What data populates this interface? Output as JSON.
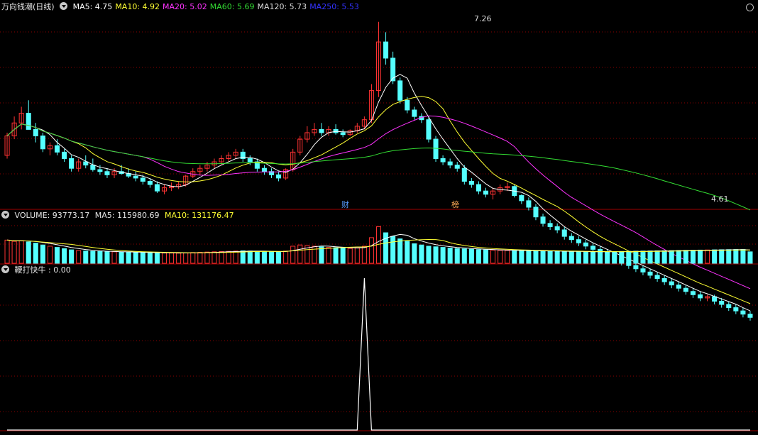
{
  "price_panel": {
    "title": "万向钱潮(日线)",
    "ma": [
      {
        "label": "MA5: 4.75",
        "color": "#ffffff"
      },
      {
        "label": "MA10: 4.92",
        "color": "#ffff33"
      },
      {
        "label": "MA20: 5.02",
        "color": "#ff33ff"
      },
      {
        "label": "MA60: 5.69",
        "color": "#33dd33"
      },
      {
        "label": "MA120: 5.73",
        "color": "#dddddd"
      },
      {
        "label": "MA250: 5.53",
        "color": "#3333ff"
      }
    ],
    "high_label": "7.26",
    "low_label": "4.61",
    "marker_cai": "财",
    "marker_bang": "榜"
  },
  "volume_panel": {
    "label": "VOLUME: 93773.17",
    "ma5": "MA5: 115980.69",
    "ma10": "MA10: 131176.47"
  },
  "indicator_panel": {
    "label": "鞭打快牛 : 0.00"
  },
  "colors": {
    "up": "#ff3333",
    "down": "#55ffff",
    "grid": "#8b0000",
    "axis": "#a00000"
  },
  "chart_data": [
    {
      "type": "candlestick",
      "title": "万向钱潮(日线)",
      "ohlc": [
        [
          5.2,
          5.55,
          5.15,
          5.5
        ],
        [
          5.5,
          5.8,
          5.45,
          5.7
        ],
        [
          5.7,
          5.95,
          5.6,
          5.85
        ],
        [
          5.85,
          6.05,
          5.75,
          5.6
        ],
        [
          5.6,
          5.7,
          5.4,
          5.5
        ],
        [
          5.5,
          5.55,
          5.25,
          5.3
        ],
        [
          5.3,
          5.4,
          5.2,
          5.35
        ],
        [
          5.35,
          5.45,
          5.2,
          5.25
        ],
        [
          5.25,
          5.3,
          5.1,
          5.15
        ],
        [
          5.15,
          5.2,
          4.95,
          5.0
        ],
        [
          5.0,
          5.15,
          4.95,
          5.1
        ],
        [
          5.1,
          5.2,
          5.0,
          5.05
        ],
        [
          5.05,
          5.15,
          4.95,
          4.98
        ],
        [
          4.98,
          5.05,
          4.9,
          4.95
        ],
        [
          4.95,
          5.0,
          4.85,
          4.9
        ],
        [
          4.9,
          5.0,
          4.85,
          4.95
        ],
        [
          4.95,
          5.05,
          4.9,
          4.92
        ],
        [
          4.92,
          5.0,
          4.85,
          4.88
        ],
        [
          4.88,
          4.95,
          4.8,
          4.85
        ],
        [
          4.85,
          4.9,
          4.75,
          4.8
        ],
        [
          4.8,
          4.85,
          4.7,
          4.75
        ],
        [
          4.75,
          4.8,
          4.62,
          4.65
        ],
        [
          4.65,
          4.75,
          4.6,
          4.7
        ],
        [
          4.7,
          4.78,
          4.65,
          4.72
        ],
        [
          4.72,
          4.8,
          4.68,
          4.75
        ],
        [
          4.75,
          4.9,
          4.72,
          4.88
        ],
        [
          4.88,
          5.0,
          4.85,
          4.95
        ],
        [
          4.95,
          5.05,
          4.9,
          5.0
        ],
        [
          5.0,
          5.1,
          4.95,
          5.05
        ],
        [
          5.05,
          5.15,
          5.0,
          5.1
        ],
        [
          5.1,
          5.2,
          5.05,
          5.15
        ],
        [
          5.15,
          5.25,
          5.1,
          5.2
        ],
        [
          5.2,
          5.3,
          5.15,
          5.25
        ],
        [
          5.25,
          5.3,
          5.1,
          5.15
        ],
        [
          5.15,
          5.2,
          5.05,
          5.1
        ],
        [
          5.1,
          5.15,
          4.95,
          5.0
        ],
        [
          5.0,
          5.05,
          4.9,
          4.95
        ],
        [
          4.95,
          5.0,
          4.85,
          4.9
        ],
        [
          4.9,
          4.95,
          4.8,
          4.85
        ],
        [
          4.85,
          5.0,
          4.82,
          4.98
        ],
        [
          4.98,
          5.3,
          4.95,
          5.25
        ],
        [
          5.25,
          5.5,
          5.2,
          5.45
        ],
        [
          5.45,
          5.65,
          5.4,
          5.55
        ],
        [
          5.55,
          5.7,
          5.5,
          5.6
        ],
        [
          5.6,
          5.7,
          5.5,
          5.55
        ],
        [
          5.55,
          5.65,
          5.5,
          5.6
        ],
        [
          5.6,
          5.68,
          5.52,
          5.55
        ],
        [
          5.55,
          5.6,
          5.48,
          5.52
        ],
        [
          5.52,
          5.6,
          5.5,
          5.58
        ],
        [
          5.58,
          5.7,
          5.55,
          5.65
        ],
        [
          5.65,
          5.8,
          5.6,
          5.75
        ],
        [
          5.75,
          6.3,
          5.7,
          6.2
        ],
        [
          6.2,
          7.26,
          6.1,
          6.95
        ],
        [
          6.95,
          7.1,
          6.6,
          6.7
        ],
        [
          6.7,
          6.8,
          6.3,
          6.35
        ],
        [
          6.35,
          6.4,
          6.0,
          6.05
        ],
        [
          6.05,
          6.1,
          5.85,
          5.9
        ],
        [
          5.9,
          5.95,
          5.75,
          5.8
        ],
        [
          5.8,
          5.85,
          5.7,
          5.75
        ],
        [
          5.75,
          5.8,
          5.4,
          5.45
        ],
        [
          5.45,
          5.5,
          5.1,
          5.15
        ],
        [
          5.15,
          5.2,
          5.05,
          5.1
        ],
        [
          5.1,
          5.15,
          5.0,
          5.05
        ],
        [
          5.05,
          5.1,
          4.95,
          5.0
        ],
        [
          5.0,
          5.05,
          4.75,
          4.8
        ],
        [
          4.8,
          4.85,
          4.7,
          4.75
        ],
        [
          4.75,
          4.8,
          4.6,
          4.65
        ],
        [
          4.65,
          4.7,
          4.55,
          4.6
        ],
        [
          4.6,
          4.7,
          4.52,
          4.65
        ],
        [
          4.65,
          4.75,
          4.6,
          4.7
        ],
        [
          4.7,
          4.78,
          4.65,
          4.72
        ],
        [
          4.72,
          4.75,
          4.55,
          4.58
        ],
        [
          4.58,
          4.6,
          4.45,
          4.5
        ],
        [
          4.5,
          4.55,
          4.35,
          4.4
        ],
        [
          4.4,
          4.45,
          4.2,
          4.25
        ],
        [
          4.25,
          4.3,
          4.1,
          4.15
        ],
        [
          4.15,
          4.2,
          4.05,
          4.1
        ],
        [
          4.1,
          4.15,
          4.0,
          4.05
        ],
        [
          4.05,
          4.1,
          3.9,
          3.95
        ],
        [
          3.95,
          4.0,
          3.85,
          3.9
        ],
        [
          3.9,
          3.95,
          3.8,
          3.85
        ],
        [
          3.85,
          3.9,
          3.75,
          3.8
        ],
        [
          3.8,
          3.85,
          3.7,
          3.75
        ],
        [
          3.75,
          3.8,
          3.65,
          3.7
        ],
        [
          3.7,
          3.75,
          3.6,
          3.65
        ],
        [
          3.65,
          3.7,
          3.55,
          3.6
        ],
        [
          3.6,
          3.62,
          3.5,
          3.55
        ],
        [
          3.55,
          3.58,
          3.45,
          3.5
        ],
        [
          3.5,
          3.55,
          3.4,
          3.45
        ],
        [
          3.45,
          3.5,
          3.35,
          3.4
        ],
        [
          3.4,
          3.45,
          3.3,
          3.35
        ],
        [
          3.35,
          3.4,
          3.25,
          3.3
        ],
        [
          3.3,
          3.35,
          3.2,
          3.25
        ],
        [
          3.25,
          3.3,
          3.15,
          3.2
        ],
        [
          3.2,
          3.25,
          3.1,
          3.15
        ],
        [
          3.15,
          3.2,
          3.05,
          3.1
        ],
        [
          3.1,
          3.15,
          3.0,
          3.05
        ],
        [
          3.05,
          3.1,
          2.95,
          3.0
        ],
        [
          3.0,
          3.05,
          2.95,
          3.02
        ],
        [
          3.02,
          3.05,
          2.9,
          2.95
        ],
        [
          2.95,
          3.0,
          2.85,
          2.9
        ],
        [
          2.9,
          2.95,
          2.8,
          2.85
        ],
        [
          2.85,
          2.9,
          2.75,
          2.8
        ],
        [
          2.8,
          2.85,
          2.7,
          2.75
        ],
        [
          2.75,
          2.8,
          2.65,
          2.7
        ]
      ],
      "ylim": [
        4.4,
        7.4
      ]
    },
    {
      "type": "bar",
      "title": "VOLUME",
      "values": [
        190000,
        180000,
        185000,
        175000,
        165000,
        150000,
        140000,
        130000,
        120000,
        110000,
        105000,
        100000,
        98000,
        96000,
        95000,
        94000,
        92000,
        90000,
        90000,
        88000,
        86000,
        85000,
        84000,
        84000,
        83000,
        85000,
        88000,
        90000,
        92000,
        94000,
        96000,
        98000,
        100000,
        102000,
        100000,
        98000,
        96000,
        94000,
        92000,
        100000,
        140000,
        150000,
        145000,
        140000,
        135000,
        130000,
        128000,
        125000,
        122000,
        125000,
        140000,
        210000,
        300000,
        250000,
        220000,
        200000,
        180000,
        160000,
        150000,
        140000,
        135000,
        130000,
        125000,
        120000,
        118000,
        115000,
        112000,
        110000,
        108000,
        106000,
        105000,
        104000,
        103000,
        102000,
        101000,
        100000,
        99000,
        98000,
        97000,
        96000,
        95000,
        94000,
        93000,
        94000,
        95000,
        96000,
        97000,
        98000,
        99000,
        100000,
        101000,
        102000,
        103000,
        104000,
        105000,
        106000,
        107000,
        108000,
        109000,
        110000,
        111000,
        112000,
        113000,
        114000,
        93773
      ],
      "ylim": [
        0,
        320000
      ]
    },
    {
      "type": "line",
      "title": "鞭打快牛",
      "values": [
        0,
        0,
        0,
        0,
        0,
        0,
        0,
        0,
        0,
        0,
        0,
        0,
        0,
        0,
        0,
        0,
        0,
        0,
        0,
        0,
        0,
        0,
        0,
        0,
        0,
        0,
        0,
        0,
        0,
        0,
        0,
        0,
        0,
        0,
        0,
        0,
        0,
        0,
        0,
        0,
        0,
        0,
        0,
        0,
        0,
        0,
        0,
        0,
        0,
        0,
        1,
        0,
        0,
        0,
        0,
        0,
        0,
        0,
        0,
        0,
        0,
        0,
        0,
        0,
        0,
        0,
        0,
        0,
        0,
        0,
        0,
        0,
        0,
        0,
        0,
        0,
        0,
        0,
        0,
        0,
        0,
        0,
        0,
        0,
        0,
        0,
        0,
        0,
        0,
        0,
        0,
        0,
        0,
        0,
        0,
        0,
        0,
        0,
        0,
        0,
        0,
        0,
        0,
        0,
        0
      ],
      "ylim": [
        0,
        1
      ]
    }
  ]
}
